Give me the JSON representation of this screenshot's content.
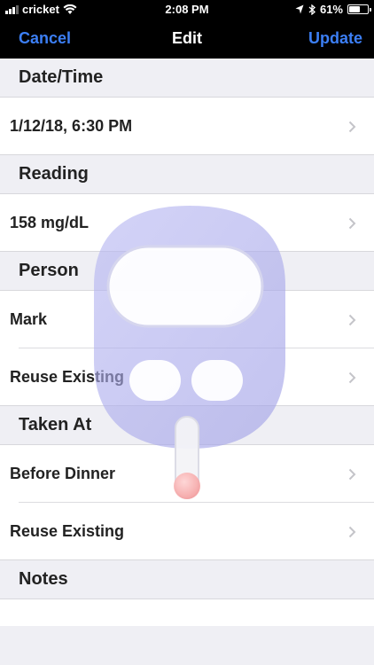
{
  "status": {
    "carrier": "cricket",
    "time": "2:08 PM",
    "battery": "61%",
    "battery_level": 0.61
  },
  "nav": {
    "cancel": "Cancel",
    "title": "Edit",
    "update": "Update"
  },
  "sections": {
    "datetime": {
      "header": "Date/Time",
      "value": "1/12/18, 6:30 PM"
    },
    "reading": {
      "header": "Reading",
      "value": "158 mg/dL"
    },
    "person": {
      "header": "Person",
      "value": "Mark",
      "reuse": "Reuse Existing"
    },
    "taken_at": {
      "header": "Taken At",
      "value": "Before Dinner",
      "reuse": "Reuse Existing"
    },
    "notes": {
      "header": "Notes"
    }
  },
  "colors": {
    "accent": "#3c7ff5",
    "watermark": "#c9c9f6"
  },
  "icons": [
    "signal-icon",
    "wifi-icon",
    "location-icon",
    "bluetooth-icon",
    "battery-icon",
    "chevron-right-icon",
    "glucose-meter-icon"
  ]
}
